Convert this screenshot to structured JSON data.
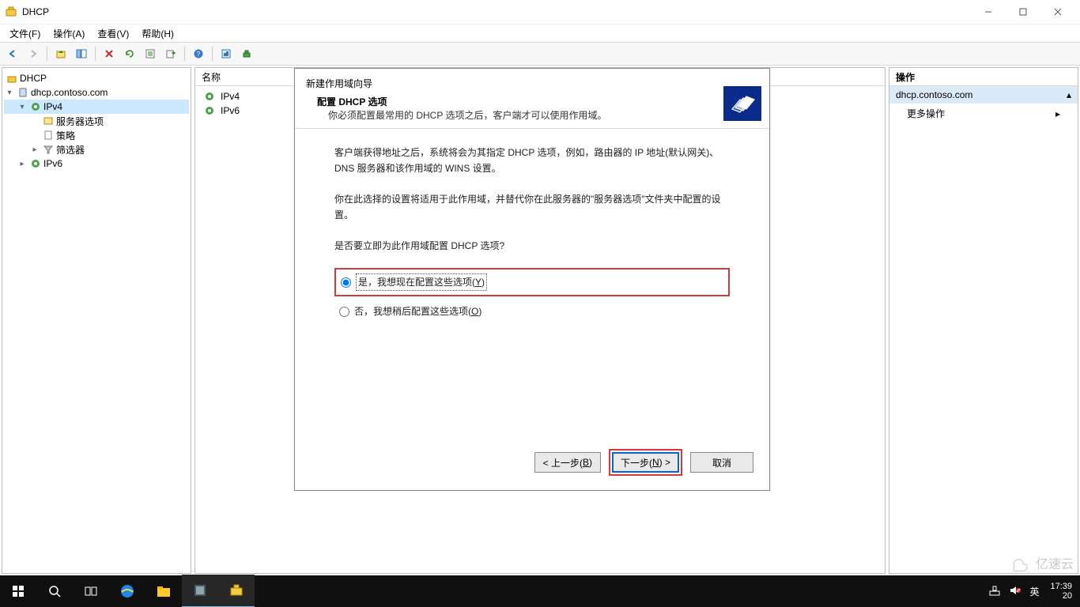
{
  "titlebar": {
    "app_name": "DHCP"
  },
  "menubar": {
    "file": "文件(F)",
    "action": "操作(A)",
    "view": "查看(V)",
    "help": "帮助(H)"
  },
  "tree": {
    "root": "DHCP",
    "server": "dhcp.contoso.com",
    "ipv4": "IPv4",
    "server_options": "服务器选项",
    "policies": "策略",
    "filters": "筛选器",
    "ipv6": "IPv6"
  },
  "list": {
    "header_name": "名称",
    "ipv4": "IPv4",
    "ipv6": "IPv6"
  },
  "actions_pane": {
    "header": "操作",
    "context": "dhcp.contoso.com",
    "more": "更多操作"
  },
  "wizard": {
    "title": "新建作用域向导",
    "subtitle": "配置 DHCP 选项",
    "subtitle_desc": "你必须配置最常用的 DHCP 选项之后，客户端才可以使用作用域。",
    "para1": "客户端获得地址之后，系统将会为其指定 DHCP 选项，例如，路由器的 IP 地址(默认网关)、DNS 服务器和该作用域的 WINS 设置。",
    "para2": "你在此选择的设置将适用于此作用域，并替代你在此服务器的\"服务器选项\"文件夹中配置的设置。",
    "para3": "是否要立即为此作用域配置 DHCP 选项?",
    "opt_yes_pre": "是，我想现在配置这些选项(",
    "opt_yes_mn": "Y",
    "opt_yes_post": ")",
    "opt_no_pre": "否，我想稍后配置这些选项(",
    "opt_no_mn": "O",
    "opt_no_post": ")",
    "btn_back_pre": "< 上一步(",
    "btn_back_mn": "B",
    "btn_back_post": ")",
    "btn_next_pre": "下一步(",
    "btn_next_mn": "N",
    "btn_next_post": ") >",
    "btn_cancel": "取消"
  },
  "taskbar": {
    "ime": "英",
    "time": "17:39",
    "date_partial": "20"
  },
  "watermark": {
    "text": "亿速云"
  }
}
